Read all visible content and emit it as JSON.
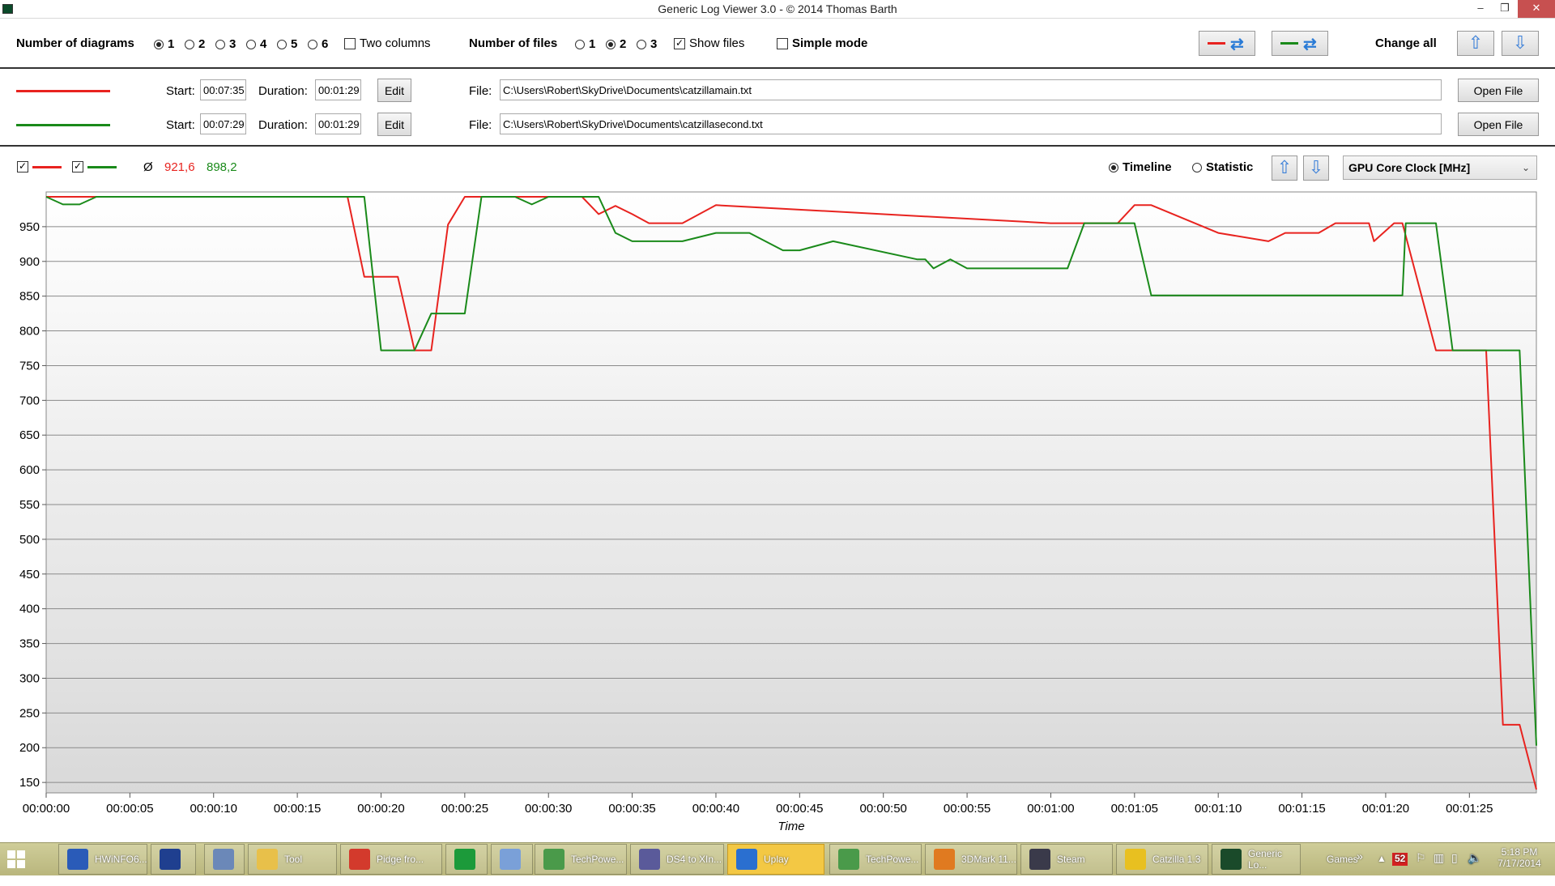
{
  "window": {
    "title": "Generic Log Viewer 3.0 - © 2014 Thomas Barth",
    "minimize": "–",
    "restore": "❐",
    "close": "✕"
  },
  "controls": {
    "diagrams_label": "Number of diagrams",
    "diagram_options": [
      "1",
      "2",
      "3",
      "4",
      "5",
      "6"
    ],
    "diagram_selected": "1",
    "two_columns_label": "Two columns",
    "two_columns_checked": false,
    "files_label": "Number of files",
    "file_options": [
      "1",
      "2",
      "3"
    ],
    "file_selected": "2",
    "show_files_label": "Show files",
    "show_files_checked": true,
    "simple_mode_label": "Simple mode",
    "simple_mode_checked": false,
    "change_all_label": "Change all"
  },
  "files": [
    {
      "color": "#e8231f",
      "start_label": "Start:",
      "start": "00:07:35",
      "duration_label": "Duration:",
      "duration": "00:01:29",
      "edit_label": "Edit",
      "file_label": "File:",
      "path": "C:\\Users\\Robert\\SkyDrive\\Documents\\catzillamain.txt",
      "open_label": "Open File"
    },
    {
      "color": "#1a8a1a",
      "start_label": "Start:",
      "start": "00:07:29",
      "duration_label": "Duration:",
      "duration": "00:01:29",
      "edit_label": "Edit",
      "file_label": "File:",
      "path": "C:\\Users\\Robert\\SkyDrive\\Documents\\catzillasecond.txt",
      "open_label": "Open File"
    }
  ],
  "chart_header": {
    "avg_symbol": "Ø",
    "avg_red": "921,6",
    "avg_green": "898,2",
    "timeline_label": "Timeline",
    "statistic_label": "Statistic",
    "view_selected": "Timeline",
    "sensor": "GPU Core Clock [MHz]"
  },
  "chart_data": {
    "type": "line",
    "xlabel": "Time",
    "ylabel": "",
    "ylim": [
      135,
      1000
    ],
    "xlim": [
      0,
      89
    ],
    "grid": true,
    "y_ticks": [
      150,
      200,
      250,
      300,
      350,
      400,
      450,
      500,
      550,
      600,
      650,
      700,
      750,
      800,
      850,
      900,
      950
    ],
    "x_ticks": [
      {
        "t": 0,
        "label": "00:00:00"
      },
      {
        "t": 5,
        "label": "00:00:05"
      },
      {
        "t": 10,
        "label": "00:00:10"
      },
      {
        "t": 15,
        "label": "00:00:15"
      },
      {
        "t": 20,
        "label": "00:00:20"
      },
      {
        "t": 25,
        "label": "00:00:25"
      },
      {
        "t": 30,
        "label": "00:00:30"
      },
      {
        "t": 35,
        "label": "00:00:35"
      },
      {
        "t": 40,
        "label": "00:00:40"
      },
      {
        "t": 45,
        "label": "00:00:45"
      },
      {
        "t": 50,
        "label": "00:00:50"
      },
      {
        "t": 55,
        "label": "00:00:55"
      },
      {
        "t": 60,
        "label": "00:01:00"
      },
      {
        "t": 65,
        "label": "00:01:05"
      },
      {
        "t": 70,
        "label": "00:01:10"
      },
      {
        "t": 75,
        "label": "00:01:15"
      },
      {
        "t": 80,
        "label": "00:01:20"
      },
      {
        "t": 85,
        "label": "00:01:25"
      }
    ],
    "series": [
      {
        "color": "#e8231f",
        "x": [
          0,
          18,
          19,
          21,
          22,
          23,
          24,
          25,
          28,
          30,
          32,
          33,
          34,
          35,
          36,
          38,
          40,
          60,
          61,
          64,
          65,
          66,
          70,
          73,
          74,
          76,
          77,
          79,
          79.3,
          80.5,
          81,
          83,
          86,
          87,
          88,
          89
        ],
        "y": [
          993,
          993,
          878,
          878,
          772,
          772,
          953,
          993,
          993,
          993,
          993,
          968,
          980,
          968,
          955,
          955,
          981,
          955,
          955,
          955,
          981,
          981,
          941,
          929,
          941,
          941,
          955,
          955,
          929,
          955,
          955,
          772,
          772,
          233,
          233,
          140
        ]
      },
      {
        "color": "#1a8a1a",
        "x": [
          0,
          1,
          2,
          3,
          19,
          20,
          22,
          23,
          25,
          26,
          28,
          29,
          30,
          33,
          34,
          35,
          38,
          40,
          42,
          44,
          45,
          47,
          52,
          52.5,
          53,
          54,
          55,
          61,
          62,
          65,
          66,
          71,
          81,
          81.2,
          83,
          84,
          88,
          89
        ],
        "y": [
          993,
          982,
          982,
          993,
          993,
          772,
          772,
          825,
          825,
          993,
          993,
          982,
          993,
          993,
          941,
          929,
          929,
          941,
          941,
          916,
          916,
          929,
          903,
          903,
          890,
          903,
          890,
          890,
          955,
          955,
          851,
          851,
          851,
          955,
          955,
          772,
          772,
          203
        ]
      }
    ]
  },
  "taskbar": {
    "items": [
      {
        "label": "HWiNFO6...",
        "icon": "hwinfo-icon",
        "color": "#2a5bb8"
      },
      {
        "label": "",
        "icon": "keyboard-icon",
        "color": "#1f3f8f"
      },
      {
        "label": "",
        "icon": "calculator-icon",
        "color": "#6b88b8"
      },
      {
        "label": "Tool",
        "icon": "folder-icon",
        "color": "#e8c04a"
      },
      {
        "label": "Pidge fro...",
        "icon": "chrome-icon",
        "color": "#d33a2c"
      },
      {
        "label": "",
        "icon": "store-icon",
        "color": "#1c9a3a"
      },
      {
        "label": "",
        "icon": "paint-icon",
        "color": "#7aa0d8"
      },
      {
        "label": "TechPowe...",
        "icon": "gpuz-icon",
        "color": "#4a9a4a"
      },
      {
        "label": "DS4 to XIn...",
        "icon": "ds4-icon",
        "color": "#5a5a9a"
      },
      {
        "label": "Uplay",
        "icon": "uplay-icon",
        "color": "#2a6fd0"
      },
      {
        "label": "TechPowe...",
        "icon": "gpuz-icon",
        "color": "#4a9a4a"
      },
      {
        "label": "3DMark 11...",
        "icon": "3dmark-icon",
        "color": "#e07a20"
      },
      {
        "label": "Steam",
        "icon": "steam-icon",
        "color": "#3a3a4a"
      },
      {
        "label": "Catzilla 1.3",
        "icon": "catzilla-icon",
        "color": "#e8c020"
      },
      {
        "label": "Generic Lo...",
        "icon": "log-viewer-icon",
        "color": "#1a4a2a"
      }
    ],
    "tray_label": "Games",
    "tray_badge": "52",
    "time": "5:18 PM",
    "date": "7/17/2014"
  }
}
